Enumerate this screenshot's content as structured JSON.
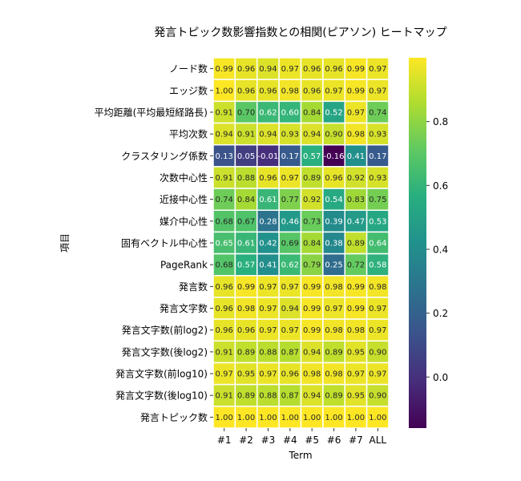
{
  "chart_data": {
    "type": "heatmap",
    "title": "発言トピック数影響指数との相関(ピアソン) ヒートマップ",
    "xlabel": "Term",
    "ylabel": "項目",
    "columns": [
      "#1",
      "#2",
      "#3",
      "#4",
      "#5",
      "#6",
      "#7",
      "ALL"
    ],
    "rows": [
      "ノード数",
      "エッジ数",
      "平均距離(平均最短経路長)",
      "平均次数",
      "クラスタリング係数",
      "次数中心性",
      "近接中心性",
      "媒介中心性",
      "固有ベクトル中心性",
      "PageRank",
      "発言数",
      "発言文字数",
      "発言文字数(前log2)",
      "発言文字数(後log2)",
      "発言文字数(前log10)",
      "発言文字数(後log10)",
      "発言トピック数"
    ],
    "values": [
      [
        0.99,
        0.96,
        0.94,
        0.97,
        0.96,
        0.96,
        0.99,
        0.97
      ],
      [
        1.0,
        0.96,
        0.96,
        0.98,
        0.96,
        0.97,
        0.99,
        0.97
      ],
      [
        0.91,
        0.7,
        0.62,
        0.6,
        0.84,
        0.52,
        0.97,
        0.74
      ],
      [
        0.94,
        0.91,
        0.94,
        0.93,
        0.94,
        0.9,
        0.98,
        0.93
      ],
      [
        0.13,
        0.05,
        -0.01,
        0.17,
        0.57,
        -0.16,
        0.41,
        0.17
      ],
      [
        0.91,
        0.88,
        0.96,
        0.97,
        0.89,
        0.96,
        0.92,
        0.93
      ],
      [
        0.74,
        0.84,
        0.61,
        0.77,
        0.92,
        0.54,
        0.83,
        0.75
      ],
      [
        0.68,
        0.67,
        0.28,
        0.46,
        0.73,
        0.39,
        0.47,
        0.53
      ],
      [
        0.65,
        0.61,
        0.42,
        0.69,
        0.84,
        0.38,
        0.89,
        0.64
      ],
      [
        0.68,
        0.57,
        0.41,
        0.62,
        0.79,
        0.25,
        0.72,
        0.58
      ],
      [
        0.96,
        0.99,
        0.97,
        0.97,
        0.99,
        0.98,
        0.99,
        0.98
      ],
      [
        0.96,
        0.98,
        0.97,
        0.94,
        0.99,
        0.97,
        0.99,
        0.97
      ],
      [
        0.96,
        0.96,
        0.97,
        0.97,
        0.99,
        0.98,
        0.98,
        0.97
      ],
      [
        0.91,
        0.89,
        0.88,
        0.87,
        0.94,
        0.89,
        0.95,
        0.9
      ],
      [
        0.97,
        0.95,
        0.97,
        0.96,
        0.98,
        0.98,
        0.97,
        0.97
      ],
      [
        0.91,
        0.89,
        0.88,
        0.87,
        0.94,
        0.89,
        0.95,
        0.9
      ],
      [
        1.0,
        1.0,
        1.0,
        1.0,
        1.0,
        1.0,
        1.0,
        1.0
      ]
    ],
    "colormap": "viridis",
    "vmin": -0.16,
    "vmax": 1.0,
    "colorbar_ticks": [
      "0.0",
      "0.2",
      "0.4",
      "0.6",
      "0.8"
    ],
    "colorbar_tick_values": [
      0.0,
      0.2,
      0.4,
      0.6,
      0.8
    ],
    "colors": [
      "#440154",
      "#472d7b",
      "#3b528b",
      "#2c728e",
      "#21918c",
      "#28ae80",
      "#5ec962",
      "#addc30",
      "#fde725"
    ]
  }
}
